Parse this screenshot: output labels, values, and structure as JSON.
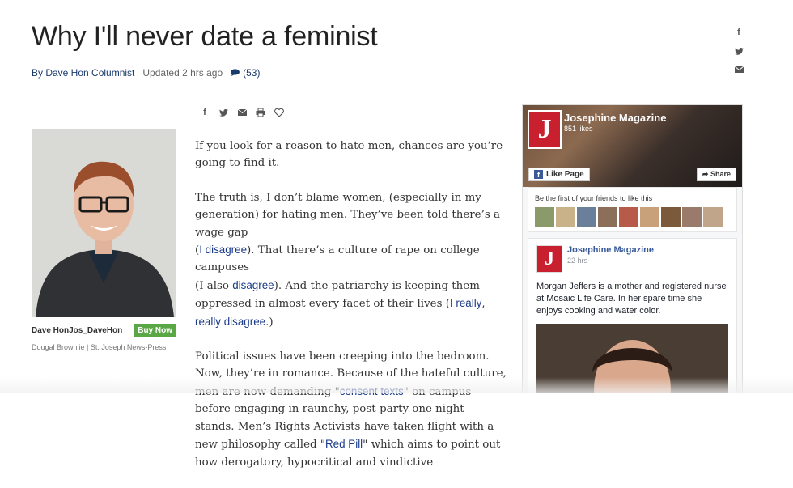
{
  "article": {
    "title": "Why I'll never date a feminist",
    "author": "By Dave Hon Columnist",
    "updated": "Updated 2 hrs ago",
    "comments": "(53)"
  },
  "icons": {
    "side_share": [
      "facebook-icon",
      "twitter-icon",
      "email-icon"
    ],
    "inline_share": [
      "facebook-icon",
      "twitter-icon",
      "email-icon",
      "print-icon",
      "heart-icon"
    ]
  },
  "photo": {
    "caption_name": "Dave HonJos_DaveHon",
    "buy_label": "Buy Now",
    "credit": "Dougal Brownlie | St. Joseph News-Press"
  },
  "body": {
    "p1": "If you look for a reason to hate men, chances are you’re going to find it.",
    "p2_a": "The truth is, I don’t blame women, (especially in my generation) for hating men. They’ve been told there’s a wage gap",
    "p2_b": "(",
    "p2_link1": "I disagree",
    "p2_c": "). That there’s a culture of rape on college campuses",
    "p2_d": "(I also ",
    "p2_link2": "disagree",
    "p2_e": "). And the patriarchy is keeping them oppressed in almost every facet of their lives (",
    "p2_link3": "I really",
    "p2_f": ", ",
    "p2_link4": "really disagree",
    "p2_g": ".)",
    "p3_a": "Political issues have been creeping into the bedroom. Now, they’re in romance. Because of the hateful culture, men are now demanding \"",
    "p3_link1": "consent texts",
    "p3_b": "\" on campus before engaging in raunchy, post-party one night stands. Men’s Rights Activists have taken flight with a new philosophy called \"",
    "p3_link2": "Red Pill",
    "p3_c": "\" which aims to point out how derogatory, hypocritical and vindictive"
  },
  "fb_widget": {
    "page_name": "Josephine Magazine",
    "likes": "851 likes",
    "like_button": "Like Page",
    "share_button": "Share",
    "friends_text": "Be the first of your friends to like this",
    "post_author": "Josephine Magazine",
    "post_time": "22 hrs",
    "post_text": "Morgan Jeffers is a mother and registered nurse at Mosaic Life Care. In her spare time she enjoys cooking and water color.",
    "logo_letter": "J",
    "face_colors": [
      "#8a9a6a",
      "#c9b28a",
      "#6a7f9a",
      "#8b6f5a",
      "#b85a4a",
      "#c8a07a",
      "#7a5a3a",
      "#9a7a6a",
      "#c0a58a",
      "#5a6a7a"
    ]
  }
}
